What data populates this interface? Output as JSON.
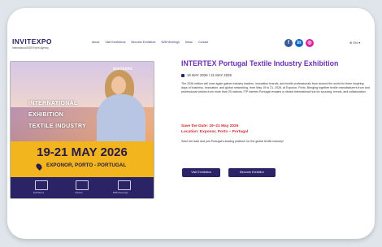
{
  "header": {
    "logo_title": "INVITEXPO",
    "logo_subtitle": "International B2B Event Agency",
    "nav": [
      "About",
      "Visit Exhibitions",
      "Become Exhibitors",
      "B2B Meetings",
      "News",
      "Contact"
    ],
    "social": [
      {
        "icon": "facebook-icon",
        "color": "#3b5998",
        "glyph": "f"
      },
      {
        "icon": "linkedin-icon",
        "color": "#0a66c2",
        "glyph": "in"
      },
      {
        "icon": "instagram-icon",
        "color": "#d6249f",
        "glyph": "◎"
      }
    ],
    "language": "EN"
  },
  "poster": {
    "brand": "INVITEXPO",
    "lines": [
      "INTERNATIONAL",
      "EXHIBITION",
      "TEXTILE INDUSTRY"
    ],
    "dates": "19-21 MAY 2026",
    "location": "EXPONOR, PORTO - PORTUGAL",
    "footer_items": [
      "Exhibitors",
      "Visitors",
      "B2B Meetings"
    ]
  },
  "event": {
    "title": "INTERTEX Portugal Textile Industry Exhibition",
    "date_range": "19 MAY 2026 / 21 MAY 2026",
    "description": "The 2026 edition will once again gather industry leaders, innovation brands, and textile professionals from around the world for three inspiring days of business, innovation, and global networking, from May 19 to 21, 2026, at Exponor, Porto. Bringing together textile manufacturers from and professional visitors from more than 25 nations, ITP Intertex Portugal remains a vibrant international hub for sourcing, trends, and collaboration.",
    "save_the_date": "Save the Date: 19–21 May 2026",
    "location": "Location: Exponor, Porto – Portugal",
    "note": "Save the date and join Portugal's leading platform for the global textile industry!"
  },
  "buttons": {
    "visit": "Visit Exhibition",
    "become": "Become Exhibitor"
  },
  "colors": {
    "brand": "#2a2466",
    "title": "#6b2fb3",
    "highlight": "#d02b2b",
    "poster_band": "#f2b51e"
  }
}
